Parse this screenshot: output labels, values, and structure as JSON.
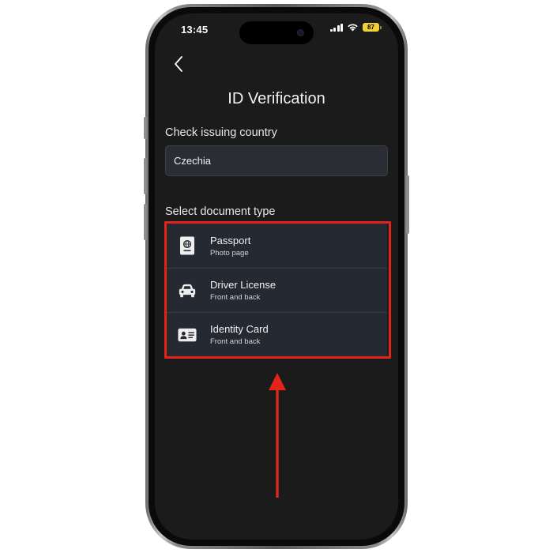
{
  "status_bar": {
    "time": "13:45",
    "battery": "87",
    "icons": [
      "signal-icon",
      "wifi-icon",
      "battery-icon"
    ]
  },
  "header": {
    "back_icon": "chevron-left-icon",
    "title": "ID Verification"
  },
  "country": {
    "label": "Check issuing country",
    "value": "Czechia"
  },
  "documents": {
    "label": "Select document type",
    "options": [
      {
        "title": "Passport",
        "subtitle": "Photo page",
        "icon": "passport-icon"
      },
      {
        "title": "Driver License",
        "subtitle": "Front and back",
        "icon": "car-icon"
      },
      {
        "title": "Identity Card",
        "subtitle": "Front and back",
        "icon": "id-card-icon"
      }
    ]
  },
  "colors": {
    "screen_bg": "#1b1b1c",
    "field_bg": "#2a2d33",
    "list_bg": "#252932",
    "highlight": "#e2251b",
    "battery": "#f0cf37"
  }
}
